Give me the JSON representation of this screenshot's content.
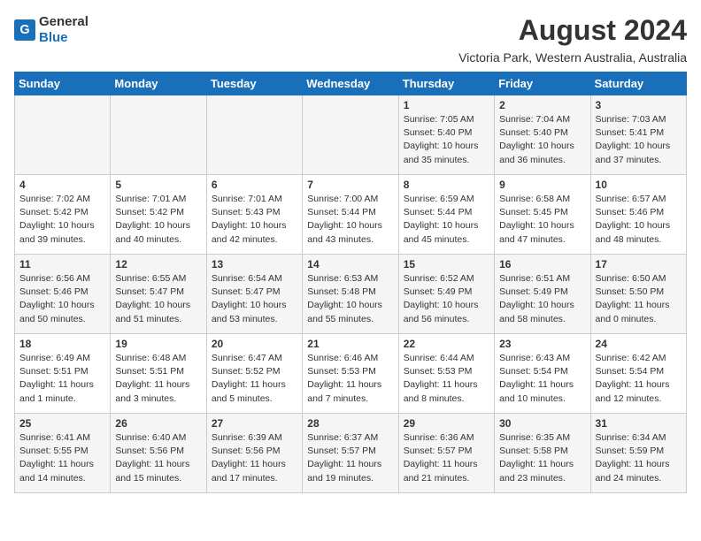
{
  "header": {
    "logo_line1": "General",
    "logo_line2": "Blue",
    "month_title": "August 2024",
    "subtitle": "Victoria Park, Western Australia, Australia"
  },
  "days_of_week": [
    "Sunday",
    "Monday",
    "Tuesday",
    "Wednesday",
    "Thursday",
    "Friday",
    "Saturday"
  ],
  "weeks": [
    [
      {
        "day": "",
        "info": ""
      },
      {
        "day": "",
        "info": ""
      },
      {
        "day": "",
        "info": ""
      },
      {
        "day": "",
        "info": ""
      },
      {
        "day": "1",
        "info": "Sunrise: 7:05 AM\nSunset: 5:40 PM\nDaylight: 10 hours\nand 35 minutes."
      },
      {
        "day": "2",
        "info": "Sunrise: 7:04 AM\nSunset: 5:40 PM\nDaylight: 10 hours\nand 36 minutes."
      },
      {
        "day": "3",
        "info": "Sunrise: 7:03 AM\nSunset: 5:41 PM\nDaylight: 10 hours\nand 37 minutes."
      }
    ],
    [
      {
        "day": "4",
        "info": "Sunrise: 7:02 AM\nSunset: 5:42 PM\nDaylight: 10 hours\nand 39 minutes."
      },
      {
        "day": "5",
        "info": "Sunrise: 7:01 AM\nSunset: 5:42 PM\nDaylight: 10 hours\nand 40 minutes."
      },
      {
        "day": "6",
        "info": "Sunrise: 7:01 AM\nSunset: 5:43 PM\nDaylight: 10 hours\nand 42 minutes."
      },
      {
        "day": "7",
        "info": "Sunrise: 7:00 AM\nSunset: 5:44 PM\nDaylight: 10 hours\nand 43 minutes."
      },
      {
        "day": "8",
        "info": "Sunrise: 6:59 AM\nSunset: 5:44 PM\nDaylight: 10 hours\nand 45 minutes."
      },
      {
        "day": "9",
        "info": "Sunrise: 6:58 AM\nSunset: 5:45 PM\nDaylight: 10 hours\nand 47 minutes."
      },
      {
        "day": "10",
        "info": "Sunrise: 6:57 AM\nSunset: 5:46 PM\nDaylight: 10 hours\nand 48 minutes."
      }
    ],
    [
      {
        "day": "11",
        "info": "Sunrise: 6:56 AM\nSunset: 5:46 PM\nDaylight: 10 hours\nand 50 minutes."
      },
      {
        "day": "12",
        "info": "Sunrise: 6:55 AM\nSunset: 5:47 PM\nDaylight: 10 hours\nand 51 minutes."
      },
      {
        "day": "13",
        "info": "Sunrise: 6:54 AM\nSunset: 5:47 PM\nDaylight: 10 hours\nand 53 minutes."
      },
      {
        "day": "14",
        "info": "Sunrise: 6:53 AM\nSunset: 5:48 PM\nDaylight: 10 hours\nand 55 minutes."
      },
      {
        "day": "15",
        "info": "Sunrise: 6:52 AM\nSunset: 5:49 PM\nDaylight: 10 hours\nand 56 minutes."
      },
      {
        "day": "16",
        "info": "Sunrise: 6:51 AM\nSunset: 5:49 PM\nDaylight: 10 hours\nand 58 minutes."
      },
      {
        "day": "17",
        "info": "Sunrise: 6:50 AM\nSunset: 5:50 PM\nDaylight: 11 hours\nand 0 minutes."
      }
    ],
    [
      {
        "day": "18",
        "info": "Sunrise: 6:49 AM\nSunset: 5:51 PM\nDaylight: 11 hours\nand 1 minute."
      },
      {
        "day": "19",
        "info": "Sunrise: 6:48 AM\nSunset: 5:51 PM\nDaylight: 11 hours\nand 3 minutes."
      },
      {
        "day": "20",
        "info": "Sunrise: 6:47 AM\nSunset: 5:52 PM\nDaylight: 11 hours\nand 5 minutes."
      },
      {
        "day": "21",
        "info": "Sunrise: 6:46 AM\nSunset: 5:53 PM\nDaylight: 11 hours\nand 7 minutes."
      },
      {
        "day": "22",
        "info": "Sunrise: 6:44 AM\nSunset: 5:53 PM\nDaylight: 11 hours\nand 8 minutes."
      },
      {
        "day": "23",
        "info": "Sunrise: 6:43 AM\nSunset: 5:54 PM\nDaylight: 11 hours\nand 10 minutes."
      },
      {
        "day": "24",
        "info": "Sunrise: 6:42 AM\nSunset: 5:54 PM\nDaylight: 11 hours\nand 12 minutes."
      }
    ],
    [
      {
        "day": "25",
        "info": "Sunrise: 6:41 AM\nSunset: 5:55 PM\nDaylight: 11 hours\nand 14 minutes."
      },
      {
        "day": "26",
        "info": "Sunrise: 6:40 AM\nSunset: 5:56 PM\nDaylight: 11 hours\nand 15 minutes."
      },
      {
        "day": "27",
        "info": "Sunrise: 6:39 AM\nSunset: 5:56 PM\nDaylight: 11 hours\nand 17 minutes."
      },
      {
        "day": "28",
        "info": "Sunrise: 6:37 AM\nSunset: 5:57 PM\nDaylight: 11 hours\nand 19 minutes."
      },
      {
        "day": "29",
        "info": "Sunrise: 6:36 AM\nSunset: 5:57 PM\nDaylight: 11 hours\nand 21 minutes."
      },
      {
        "day": "30",
        "info": "Sunrise: 6:35 AM\nSunset: 5:58 PM\nDaylight: 11 hours\nand 23 minutes."
      },
      {
        "day": "31",
        "info": "Sunrise: 6:34 AM\nSunset: 5:59 PM\nDaylight: 11 hours\nand 24 minutes."
      }
    ]
  ]
}
